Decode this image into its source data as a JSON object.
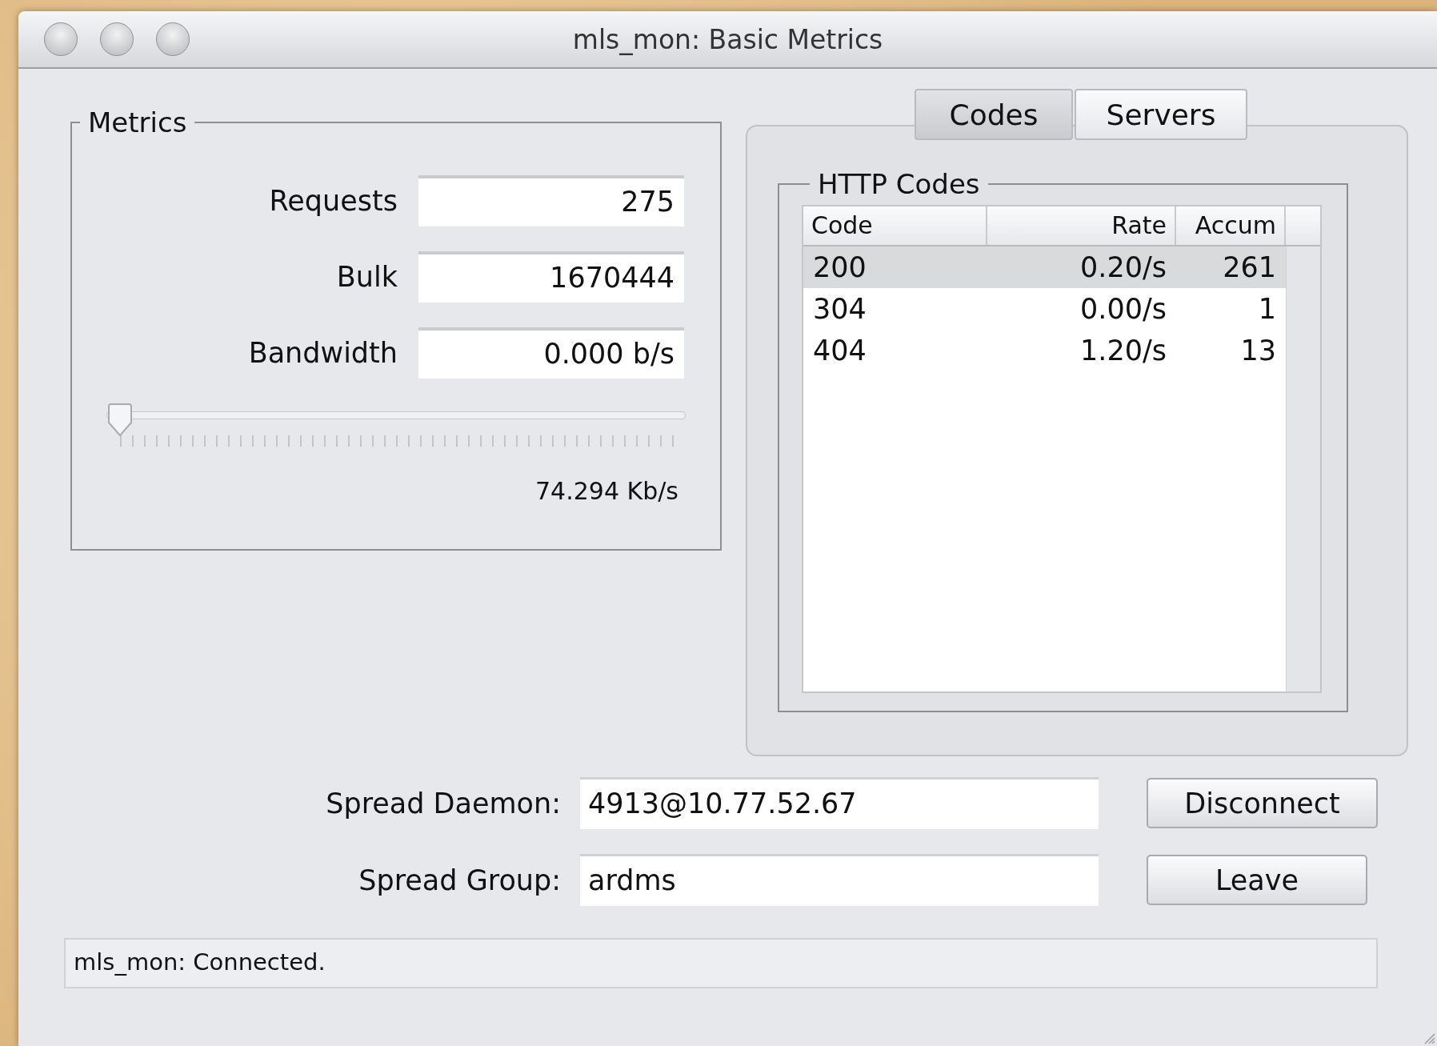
{
  "window": {
    "title": "mls_mon: Basic Metrics"
  },
  "metrics": {
    "title": "Metrics",
    "fields": [
      {
        "label": "Requests",
        "value": "275"
      },
      {
        "label": "Bulk",
        "value": "1670444"
      },
      {
        "label": "Bandwidth",
        "value": "0.000 b/s"
      }
    ],
    "slider": {
      "level": 0,
      "reading": "74.294 Kb/s"
    }
  },
  "tabs": [
    {
      "label": "Codes",
      "selected": true
    },
    {
      "label": "Servers",
      "selected": false
    }
  ],
  "http_codes": {
    "title": "HTTP Codes",
    "columns": [
      "Code",
      "Rate",
      "Accum"
    ],
    "rows": [
      {
        "cells": [
          "200",
          "0.20/s",
          "261"
        ],
        "selected": true
      },
      {
        "cells": [
          "304",
          "0.00/s",
          "1"
        ],
        "selected": false
      },
      {
        "cells": [
          "404",
          "1.20/s",
          "13"
        ],
        "selected": false
      }
    ]
  },
  "connection": [
    {
      "label": "Spread Daemon:",
      "value": "4913@10.77.52.67",
      "button": "Disconnect"
    },
    {
      "label": "Spread Group:",
      "value": "ardms",
      "button": "Leave"
    }
  ],
  "status_bar": "mls_mon: Connected."
}
